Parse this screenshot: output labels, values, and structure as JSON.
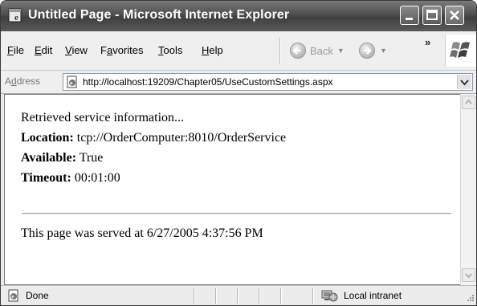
{
  "window": {
    "title": "Untitled Page - Microsoft Internet Explorer"
  },
  "menu": {
    "file": "ile",
    "file_key": "F",
    "edit": "dit",
    "edit_key": "E",
    "view": "iew",
    "view_key": "V",
    "favorites_pre": "F",
    "favorites_key": "a",
    "favorites_post": "vorites",
    "tools": "ools",
    "tools_key": "T",
    "help": "elp",
    "help_key": "H"
  },
  "toolbar": {
    "back_label": "Back",
    "overflow": "»"
  },
  "address": {
    "label_pre": "A",
    "label_key": "d",
    "label_post": "dress",
    "url": "http://localhost:19209/Chapter05/UseCustomSettings.aspx"
  },
  "page": {
    "line1": "Retrieved service information...",
    "location_label": "Location:",
    "location_value": " tcp://OrderComputer:8010/OrderService",
    "available_label": "Available:",
    "available_value": " True",
    "timeout_label": "Timeout:",
    "timeout_value": " 00:01:00",
    "served": "This page was served at 6/27/2005 4:37:56 PM"
  },
  "status": {
    "text": "Done",
    "zone": "Local intranet"
  },
  "icons": [
    "ie-app-icon",
    "minimize-icon",
    "maximize-icon",
    "close-icon",
    "back-arrow-icon",
    "forward-arrow-icon",
    "windows-logo-icon",
    "page-icon",
    "dropdown-arrow-icon",
    "scroll-up-icon",
    "scroll-down-icon",
    "done-page-icon",
    "local-intranet-icon",
    "resize-grip-icon"
  ]
}
